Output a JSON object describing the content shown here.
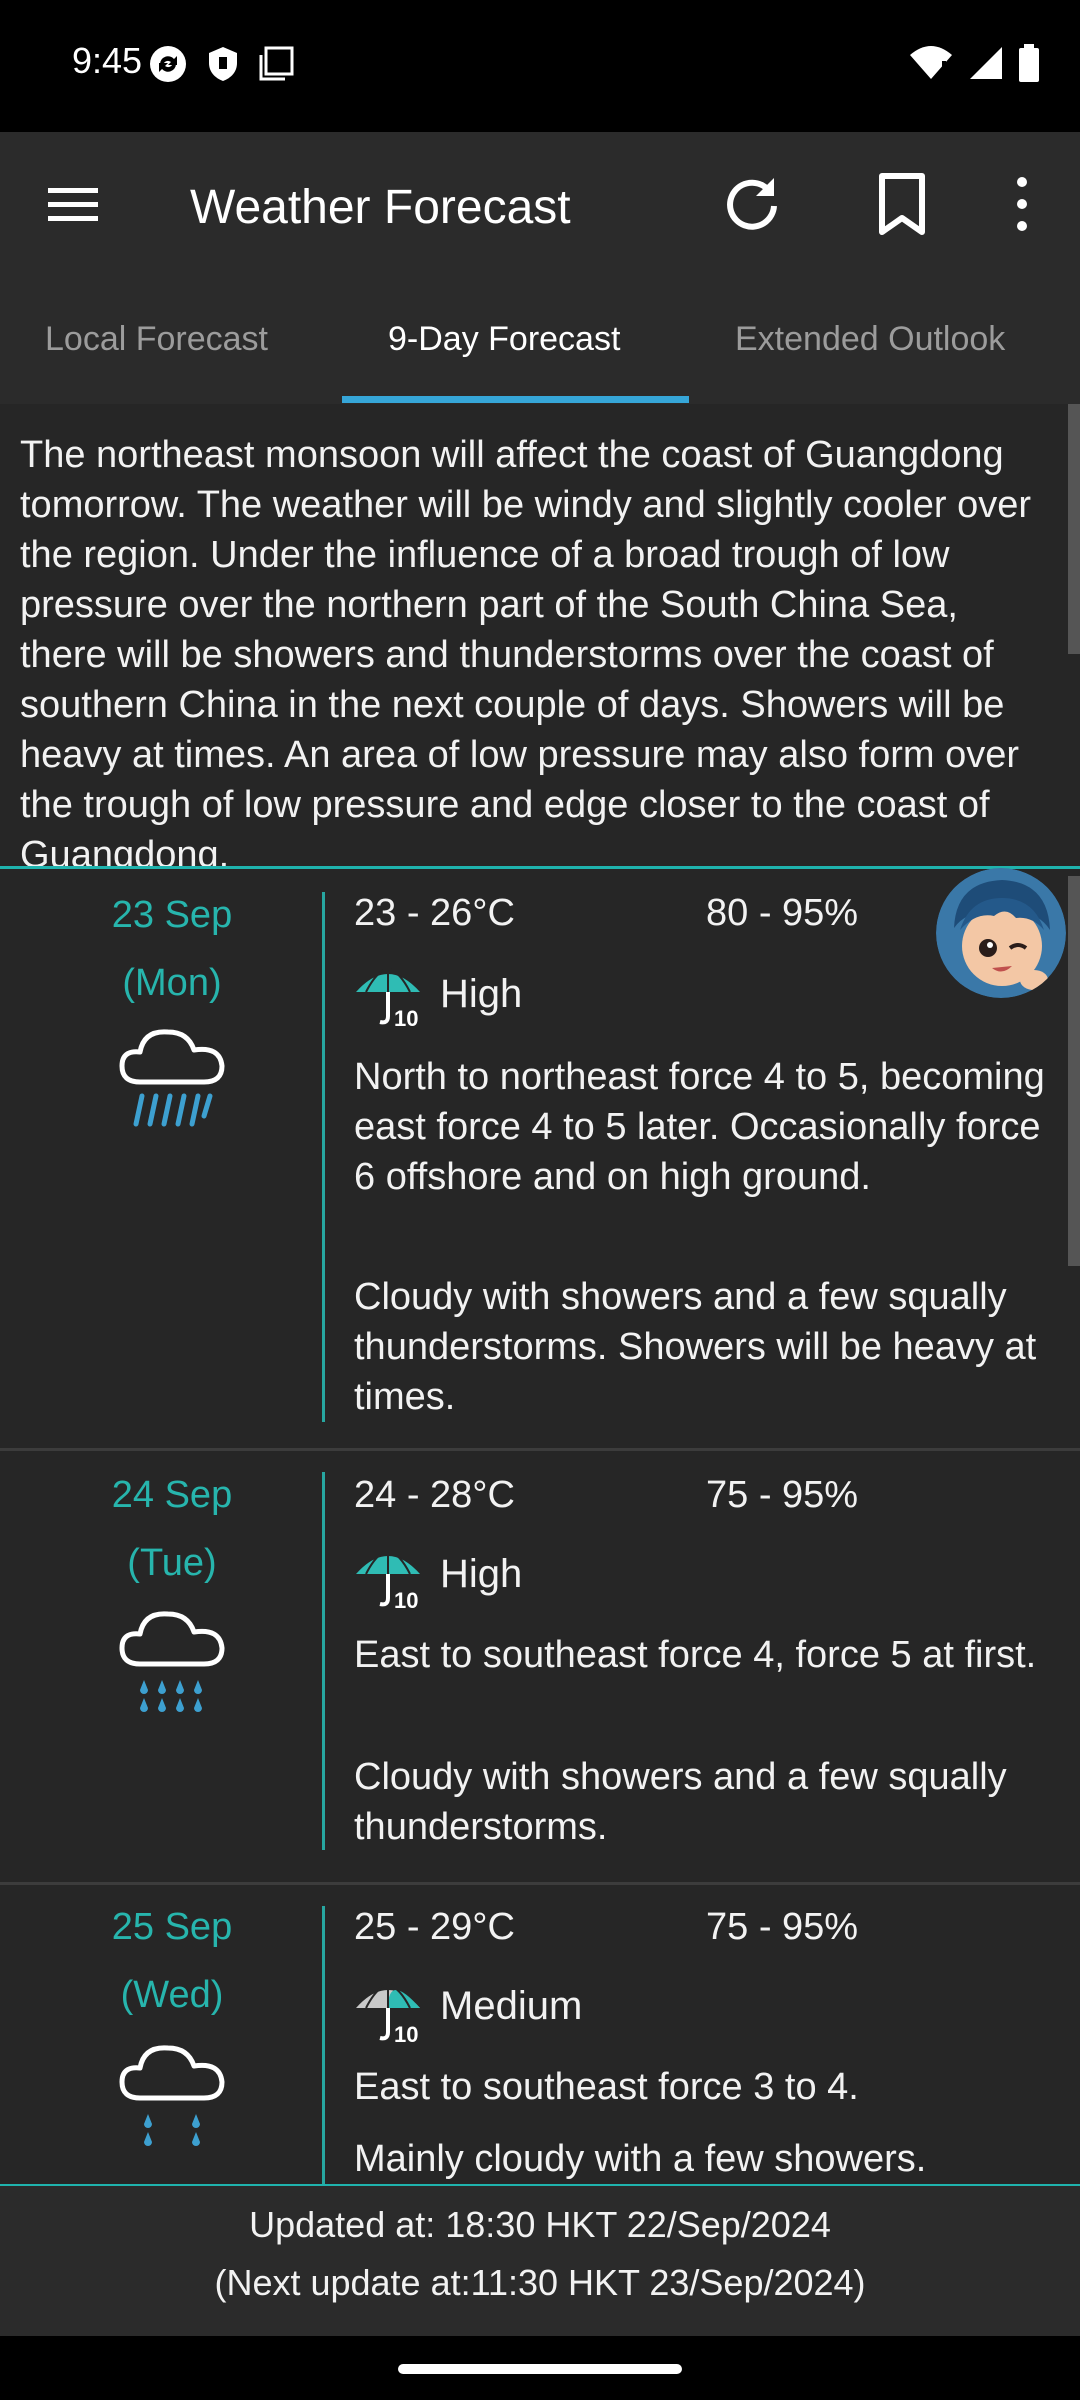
{
  "status_bar": {
    "time": "9:45"
  },
  "app_bar": {
    "title": "Weather Forecast"
  },
  "tabs": [
    {
      "label": "Local Forecast",
      "active": false
    },
    {
      "label": "9-Day Forecast",
      "active": true
    },
    {
      "label": "Extended Outlook",
      "active": false
    }
  ],
  "general_situation": "The northeast monsoon will affect the coast of Guangdong tomorrow. The weather will be windy and slightly cooler over the region. Under the influence of a broad trough of low pressure over the northern part of the South China Sea, there will be showers and thunderstorms over the coast of southern China in the next couple of days. Showers will be heavy at times. An area of low pressure may also form over the trough of low pressure and edge closer to the coast of Guangdong.",
  "forecast": [
    {
      "date": "23 Sep",
      "weekday": "(Mon)",
      "icon": "heavy-rain-icon",
      "temp": "23 - 26°C",
      "humidity": "80 - 95%",
      "psr": "High",
      "wind": "North to northeast force 4 to 5, becoming east force 4 to 5 later. Occasionally force 6 offshore and on high ground.",
      "desc": "Cloudy with showers and a few squally thunderstorms. Showers will be heavy at times."
    },
    {
      "date": "24 Sep",
      "weekday": "(Tue)",
      "icon": "showers-icon",
      "temp": "24 - 28°C",
      "humidity": "75 - 95%",
      "psr": "High",
      "wind": "East to southeast force 4, force 5 at first.",
      "desc": "Cloudy with showers and a few squally thunderstorms."
    },
    {
      "date": "25 Sep",
      "weekday": "(Wed)",
      "icon": "light-rain-icon",
      "temp": "25 - 29°C",
      "humidity": "75 - 95%",
      "psr": "Medium",
      "wind": "East to southeast force 3 to 4.",
      "desc": "Mainly cloudy with a few showers."
    }
  ],
  "footer": {
    "updated": "Updated at: 18:30 HKT 22/Sep/2024",
    "next_update": "(Next update at:11:30 HKT 23/Sep/2024)"
  },
  "colors": {
    "accent": "#36a6d8",
    "teal": "#27b5ad",
    "rain": "#3da0d0"
  }
}
